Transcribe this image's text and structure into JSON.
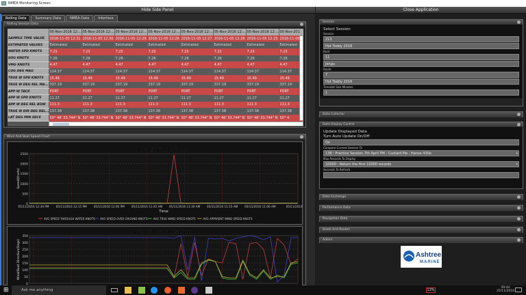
{
  "window": {
    "title": "NMEA Monitoring Screen"
  },
  "header": {
    "hide_side_panel": "Hide Side Panel",
    "close_application": "Close Application"
  },
  "tabs": [
    {
      "label": "Rolling Data",
      "active": true
    },
    {
      "label": "Summary Data"
    },
    {
      "label": "NMEA Data"
    },
    {
      "label": "Interface"
    }
  ],
  "rolling": {
    "title": "Rolling Session Data",
    "columns": [
      "05-Nov-2016 12:...",
      "05-Nov-2016 12:...",
      "05-Nov-2016 12:...",
      "05-Nov-2016 12:...",
      "05-Nov-2016 12:...",
      "05-Nov-2016 12:...",
      "05-Nov-2016 12:...",
      "05-Nov-201"
    ],
    "rows": [
      {
        "label": "SAMPLE TIME VALUE",
        "color": "red",
        "values": [
          "2016-11-05 12:31...",
          "2016-11-05 12:30...",
          "2016-11-05 12:29...",
          "2016-11-05 12:28...",
          "2016-11-05 12:27...",
          "2016-11-05 12:26...",
          "2016-11-05 12:25...",
          "2016-11-05"
        ]
      },
      {
        "label": "ESTIMATED VALUES",
        "color": "gray",
        "values": [
          "Estimated",
          "Estimated",
          "Estimated",
          "Estimated",
          "Estimated",
          "Estimated",
          "Estimated",
          "Estimated"
        ]
      },
      {
        "label": "WATER SPD KNOTS",
        "color": "red",
        "values": [
          "7.25",
          "7.25",
          "7.25",
          "7.25",
          "7.25",
          "7.25",
          "7.25",
          "7.25"
        ]
      },
      {
        "label": "SOG KNOTS",
        "color": "gray",
        "values": [
          "7.26",
          "7.26",
          "7.26",
          "7.26",
          "7.26",
          "7.26",
          "7.26",
          "7.26"
        ]
      },
      {
        "label": "VMG KNOTS",
        "color": "red",
        "values": [
          "4.47",
          "4.47",
          "4.47",
          "4.47",
          "4.47",
          "4.47",
          "4.47",
          "4.47"
        ]
      },
      {
        "label": "COG DEG MAG",
        "color": "gray",
        "values": [
          "114.37",
          "114.37",
          "114.37",
          "114.37",
          "114.37",
          "114.37",
          "114.37",
          "114.37"
        ]
      },
      {
        "label": "TRUE W SPD KNOTS",
        "color": "red",
        "values": [
          "15.49",
          "15.49",
          "15.49",
          "15.49",
          "15.49",
          "15.49",
          "15.49",
          "15.49"
        ]
      },
      {
        "label": "TRUE W DEG REL MA...",
        "color": "gray",
        "values": [
          "337.19",
          "337.19",
          "337.19",
          "337.19",
          "337.19",
          "337.19",
          "337.19",
          "337.19"
        ]
      },
      {
        "label": "APP W TACK",
        "color": "red",
        "values": [
          "PORT",
          "PORT",
          "PORT",
          "PORT",
          "PORT",
          "PORT",
          "PORT",
          "PORT"
        ]
      },
      {
        "label": "APP W SPD KNOTS",
        "color": "gray",
        "values": [
          "11.27",
          "11.27",
          "11.27",
          "11.27",
          "11.27",
          "11.27",
          "11.27",
          "11.27"
        ]
      },
      {
        "label": "APP W DEG REL BOW",
        "color": "red",
        "values": [
          "111.3",
          "111.3",
          "111.3",
          "111.3",
          "111.3",
          "111.3",
          "111.3",
          "111.3"
        ]
      },
      {
        "label": "TRUE W DIR DEG REL...",
        "color": "gray",
        "values": [
          "137.38",
          "137.38",
          "137.38",
          "137.38",
          "137.38",
          "137.38",
          "137.38",
          "137.38"
        ]
      },
      {
        "label": "LAT DEG MIN SECS",
        "color": "red",
        "values": [
          "50° 48' 33.744\" N",
          "50° 48' 33.744\" N",
          "50° 48' 33.744\" N",
          "50° 48' 33.744\" N",
          "50° 48' 33.744\" N",
          "50° 48' 33.744\" N",
          "50° 48' 33.744\" N",
          "50° 4"
        ]
      }
    ]
  },
  "wind_panel": {
    "title": "Wind And Boat Speed Chart"
  },
  "chart_data": [
    {
      "type": "line",
      "title": "Boat/Wind Speed",
      "xlabel": "Time",
      "ylabel": "Speed(Knots)",
      "ylim": [
        0,
        2500
      ],
      "yticks": [
        0,
        500,
        1000,
        1500,
        2000,
        2500
      ],
      "xticks": [
        "05/11/2016 12:30 PM",
        "05/11/2016 12:15 PM",
        "05/11/2016 12:00 PM",
        "05/11/2016 11:45 AM",
        "05/11/2016 11:30 AM",
        "05/11/2016 11:15 AM",
        "05/11/2016 11:00 AM",
        "05/11/2016 10:4"
      ],
      "grid": true,
      "legend": "bottom",
      "series": [
        {
          "name": "AVG SPEED THROUGH WATER KNOTS",
          "color": "#d04040",
          "values": [
            7,
            7,
            7,
            7,
            7,
            7,
            7,
            7,
            7,
            7,
            7,
            7,
            7,
            7,
            7,
            7,
            7,
            7,
            7,
            7,
            7,
            2450,
            7,
            7,
            7,
            7,
            7,
            7,
            7,
            7,
            7,
            7,
            7,
            7,
            7,
            7,
            7,
            7,
            7,
            7
          ]
        },
        {
          "name": "AVG SPEED OVER GROUND KNOTS",
          "color": "#4040d0",
          "values": [
            7,
            7,
            7,
            7,
            7,
            7,
            7,
            7,
            7,
            7,
            7,
            7,
            7,
            7,
            7,
            7,
            7,
            7,
            7,
            7,
            7,
            7,
            7,
            7,
            7,
            7,
            7,
            7,
            7,
            7,
            7,
            7,
            7,
            7,
            7,
            7,
            7,
            7,
            7,
            7
          ]
        },
        {
          "name": "AVG TRUE WIND SPEED KNOTS",
          "color": "#40c040",
          "values": [
            25,
            25,
            25,
            25,
            25,
            25,
            25,
            25,
            25,
            25,
            25,
            25,
            25,
            25,
            25,
            25,
            25,
            25,
            25,
            25,
            15,
            20,
            25,
            20,
            15,
            25,
            30,
            20,
            10,
            15,
            25,
            20,
            15,
            25,
            20,
            15,
            20,
            25,
            25,
            20
          ]
        },
        {
          "name": "AVG APPARENT WIND SPEED KNOTS",
          "color": "#c0a030",
          "values": [
            12,
            12,
            12,
            12,
            12,
            12,
            12,
            12,
            12,
            12,
            12,
            12,
            12,
            12,
            12,
            12,
            12,
            12,
            12,
            12,
            20,
            25,
            15,
            10,
            20,
            15,
            12,
            25,
            30,
            20,
            25,
            30,
            25,
            20,
            15,
            10,
            12,
            12,
            12,
            12
          ]
        }
      ]
    },
    {
      "type": "line",
      "title": "Wind/Boat Heading",
      "ylabel": "Wind/Boat Direction(Degs)",
      "ylim": [
        0,
        350
      ],
      "yticks": [
        0,
        50,
        100,
        150,
        200,
        250,
        300,
        350
      ],
      "grid": true,
      "series": [
        {
          "color": "#4040d0",
          "values": [
            335,
            335,
            335,
            335,
            335,
            335,
            335,
            335,
            335,
            335,
            335,
            335,
            335,
            335,
            335,
            335,
            335,
            335,
            335,
            335,
            335,
            330,
            350,
            100,
            340,
            20,
            330,
            325,
            330,
            310,
            330,
            340,
            350,
            340,
            320,
            340,
            10,
            60,
            335,
            335
          ]
        },
        {
          "color": "#c04040",
          "values": [
            115,
            115,
            115,
            115,
            115,
            115,
            115,
            115,
            115,
            115,
            115,
            115,
            115,
            115,
            115,
            115,
            115,
            115,
            115,
            115,
            115,
            40,
            290,
            50,
            300,
            60,
            180,
            160,
            150,
            300,
            290,
            30,
            290,
            300,
            250,
            40,
            330,
            280,
            140,
            180
          ]
        },
        {
          "color": "#40c040",
          "values": [
            110,
            110,
            110,
            110,
            110,
            110,
            110,
            110,
            110,
            110,
            110,
            110,
            110,
            110,
            110,
            110,
            110,
            110,
            110,
            110,
            110,
            40,
            80,
            30,
            30,
            140,
            170,
            160,
            40,
            30,
            30,
            160,
            60,
            30,
            90,
            30,
            60,
            40,
            140,
            150
          ]
        },
        {
          "color": "#c0b030",
          "values": [
            135,
            135,
            135,
            135,
            135,
            135,
            135,
            135,
            135,
            135,
            135,
            135,
            135,
            135,
            135,
            135,
            135,
            135,
            135,
            135,
            135,
            50,
            100,
            40,
            40,
            150,
            175,
            160,
            50,
            40,
            40,
            170,
            70,
            40,
            100,
            40,
            50,
            50,
            150,
            160
          ]
        }
      ]
    }
  ],
  "side": {
    "session": {
      "title": "Session",
      "heading": "Select Session",
      "session_label": "Session",
      "session_id": "213",
      "session_name": "Hot Toddy 2016",
      "boat_label": "Boat",
      "boat_id": "11",
      "boat_name": "Jengu",
      "route_label": "Route",
      "route_id": "7",
      "route_name": "Hot Toddy 2016",
      "timeslot_label": "Timeslot Size Minutes",
      "timeslot": "1"
    },
    "data_collector": "Data Collector",
    "display": {
      "title": "Data Display Control",
      "heading": "Update Displayed Data",
      "auto_label": "Turn Auto Update On/Off",
      "auto_value": "On",
      "compare_label": "Compare Current Session To",
      "compare_value": "138 : Practice Session 7th April PM : Custard Pie : Hanse 430e",
      "max_label": "Max Records To Display",
      "max_value": "10000 : Return the first 10000 records",
      "refresh_label": "Seconds To Refresh",
      "refresh_value": ""
    },
    "collapsed": [
      "Data Exchange",
      "Performance Data",
      "Navigation Data",
      "Boats And Routes",
      "Admin"
    ],
    "logo": {
      "name": "Ashtree",
      "sub": "MARINE"
    }
  },
  "taskbar": {
    "search_placeholder": "Ask me anything",
    "battery": "13%",
    "time": "09:44",
    "date": "25/11/2016"
  }
}
